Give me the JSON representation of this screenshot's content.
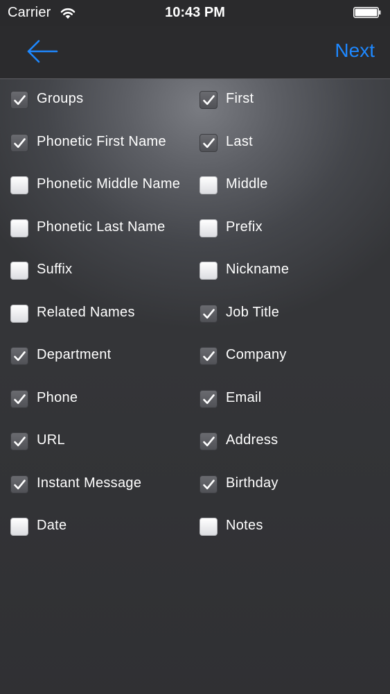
{
  "status_bar": {
    "carrier": "Carrier",
    "time": "10:43 PM"
  },
  "nav": {
    "back_icon": "arrow-left-icon",
    "next_label": "Next"
  },
  "colors": {
    "accent": "#1e88ff",
    "text": "#ffffff",
    "background": "#2b2b2d"
  },
  "fields": {
    "left": [
      {
        "label": "Groups",
        "checked": true
      },
      {
        "label": "Phonetic First Name",
        "checked": true
      },
      {
        "label": "Phonetic Middle Name",
        "checked": false
      },
      {
        "label": "Phonetic Last Name",
        "checked": false
      },
      {
        "label": "Suffix",
        "checked": false
      },
      {
        "label": "Related Names",
        "checked": false
      },
      {
        "label": "Department",
        "checked": true
      },
      {
        "label": "Phone",
        "checked": true
      },
      {
        "label": "URL",
        "checked": true
      },
      {
        "label": "Instant Message",
        "checked": true
      },
      {
        "label": "Date",
        "checked": false
      }
    ],
    "right": [
      {
        "label": "First",
        "checked": true
      },
      {
        "label": "Last",
        "checked": true
      },
      {
        "label": "Middle",
        "checked": false
      },
      {
        "label": "Prefix",
        "checked": false
      },
      {
        "label": "Nickname",
        "checked": false
      },
      {
        "label": "Job Title",
        "checked": true
      },
      {
        "label": "Company",
        "checked": true
      },
      {
        "label": "Email",
        "checked": true
      },
      {
        "label": "Address",
        "checked": true
      },
      {
        "label": "Birthday",
        "checked": true
      },
      {
        "label": "Notes",
        "checked": false
      }
    ]
  }
}
